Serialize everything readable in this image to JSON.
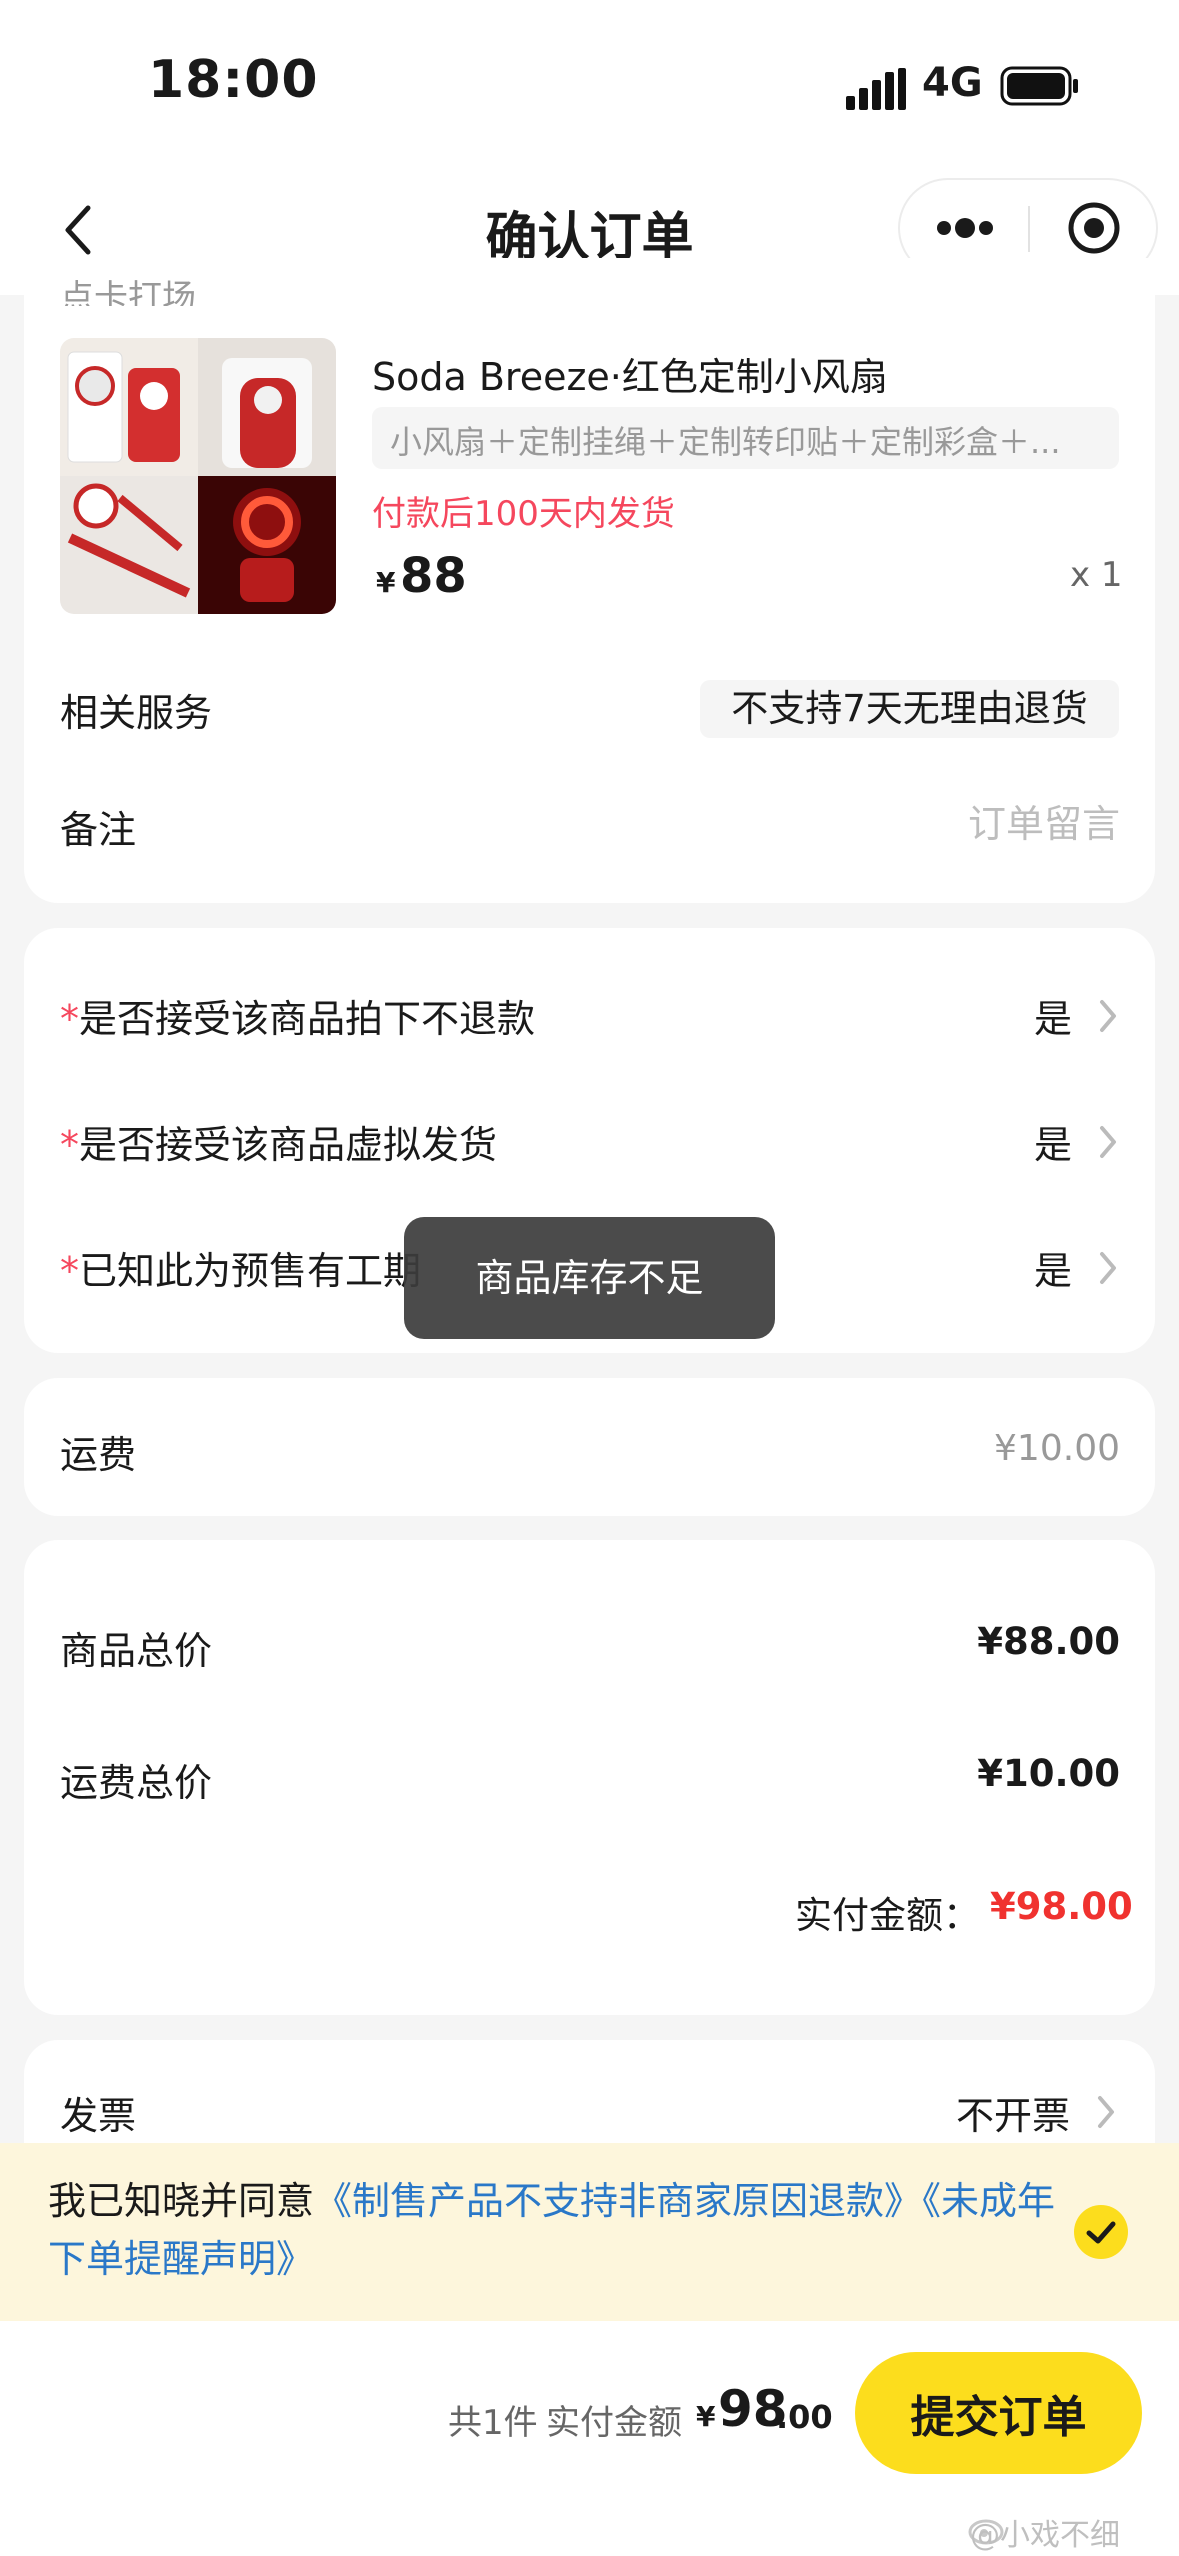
{
  "status_bar": {
    "time": "18:00",
    "network": "4G",
    "icons": [
      "signal-icon",
      "battery-icon"
    ]
  },
  "nav": {
    "title": "确认订单",
    "icons": [
      "back-icon",
      "more-icon",
      "close-target-icon"
    ]
  },
  "product_card": {
    "cut_off_label": "点卡打场",
    "product": {
      "name": "Soda Breeze·红色定制小风扇",
      "spec": "小风扇＋定制挂绳＋定制转印贴＋定制彩盒＋...",
      "ship_note": "付款后100天内发货",
      "currency": "¥",
      "price": "88",
      "quantity": "x 1"
    },
    "service": {
      "label": "相关服务",
      "badge": "不支持7天无理由退货"
    },
    "remark": {
      "label": "备注",
      "placeholder": "订单留言"
    }
  },
  "confirmations": [
    {
      "required_mark": "*",
      "question": "是否接受该商品拍下不退款",
      "answer": "是"
    },
    {
      "required_mark": "*",
      "question": "是否接受该商品虚拟发货",
      "answer": "是"
    },
    {
      "required_mark": "*",
      "question": "已知此为预售有工期",
      "answer": "是"
    }
  ],
  "freight": {
    "label": "运费",
    "value": "¥10.00"
  },
  "summary": {
    "goods_total_label": "商品总价",
    "goods_total_value": "¥88.00",
    "freight_total_label": "运费总价",
    "freight_total_value": "¥10.00",
    "paid_label": "实付金额：",
    "paid_value": "¥98.00"
  },
  "invoice": {
    "label": "发票",
    "value": "不开票"
  },
  "agreement": {
    "prefix": "我已知晓并同意",
    "link_1": "《制售产品不支持非商家原因退款》",
    "link_2": "《未成年下单提醒声明》",
    "checked": true
  },
  "bottom_bar": {
    "count": "共1件",
    "paid_label": "实付金额",
    "currency": "¥",
    "amount": "98",
    "decimal": ".00",
    "submit": "提交订单"
  },
  "toast": {
    "message": "商品库存不足"
  },
  "watermark": "@小戏不细",
  "colors": {
    "accent_yellow": "#fcdd1d",
    "price_red": "#f0322f",
    "notice_pink": "#f5475d",
    "link_blue": "#2a78c8",
    "banner_bg": "#fdf6dc"
  }
}
